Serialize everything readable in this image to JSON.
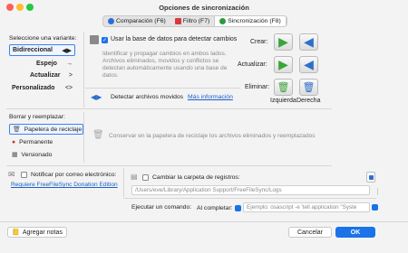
{
  "window": {
    "title": "Opciones de sincronización"
  },
  "tabs": [
    {
      "label": "Comparación (F6)",
      "icon": "compare-icon",
      "color": "#2d6fd6"
    },
    {
      "label": "Filtro (F7)",
      "icon": "filter-icon",
      "color": "#d63a3a"
    },
    {
      "label": "Sincronización (F8)",
      "icon": "sync-icon",
      "color": "#2d9a3e"
    }
  ],
  "variants": {
    "title": "Seleccione una variante:",
    "items": [
      {
        "label": "Bidireccional",
        "arrows": "<-->",
        "selected": true
      },
      {
        "label": "Espejo",
        "arrows": "->"
      },
      {
        "label": "Actualizar",
        "arrows": ">"
      },
      {
        "label": "Personalizado",
        "arrows": "<>"
      }
    ]
  },
  "database": {
    "checkbox_label": "Usar la base de datos para detectar cambios",
    "checked": true,
    "description": "Identificar y propagar cambios en ambos lados. Archivos eliminados, movidos y conflictos se detectan automáticamente usando una base de datos."
  },
  "detect_moved": {
    "label": "Detectar archivos movidos",
    "more_info": "Más información"
  },
  "actions": {
    "create_label": "Crear:",
    "update_label": "Actualizar:",
    "delete_label": "Eliminar:",
    "left_label": "Izquierda",
    "right_label": "Derecha"
  },
  "delete_replace": {
    "title": "Borrar y reemplazar:",
    "options": [
      {
        "label": "Papelera de reciclaje",
        "selected": true
      },
      {
        "label": "Permanente"
      },
      {
        "label": "Versionado"
      }
    ],
    "description": "Conservar en la papelera de reciclaje los archivos eliminados y reemplazados"
  },
  "email": {
    "label": "Notificar por correo electrónico:",
    "link": "Requiere FreeFileSync Donation Edition"
  },
  "logfile": {
    "label": "Cambiar la carpeta de registros:",
    "path": "/Users/eve/Library/Application Support/FreeFileSync/Logs"
  },
  "command": {
    "label": "Ejecutar un comando:",
    "when": "Al completar:",
    "placeholder": "Ejemplo: osascript -e 'tell application \"Syste"
  },
  "footer": {
    "add_notes": "Agregar notas",
    "cancel": "Cancelar",
    "ok": "OK"
  },
  "colors": {
    "accent": "#1a73e8",
    "green_arrow": "#3aa53a",
    "blue_arrow": "#2f6fc9"
  }
}
